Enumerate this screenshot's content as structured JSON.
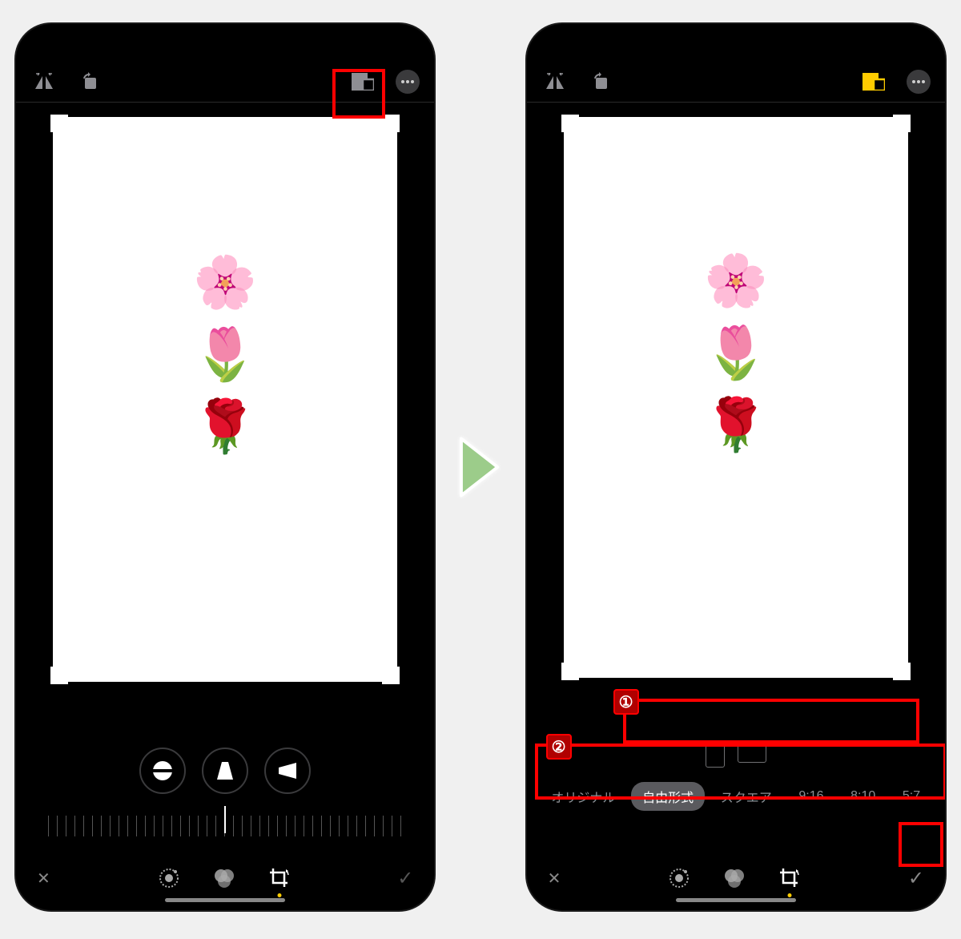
{
  "emojis": {
    "blossom": "🌸",
    "tulip": "🌷",
    "rose": "🌹"
  },
  "ratios": {
    "original": "オリジナル",
    "freeform": "自由形式",
    "square": "スクエア",
    "r916": "9:16",
    "r810": "8:10",
    "r57": "5:7"
  },
  "callouts": {
    "one": "①",
    "two": "②"
  },
  "close_glyph": "✕",
  "check_glyph": "✓"
}
